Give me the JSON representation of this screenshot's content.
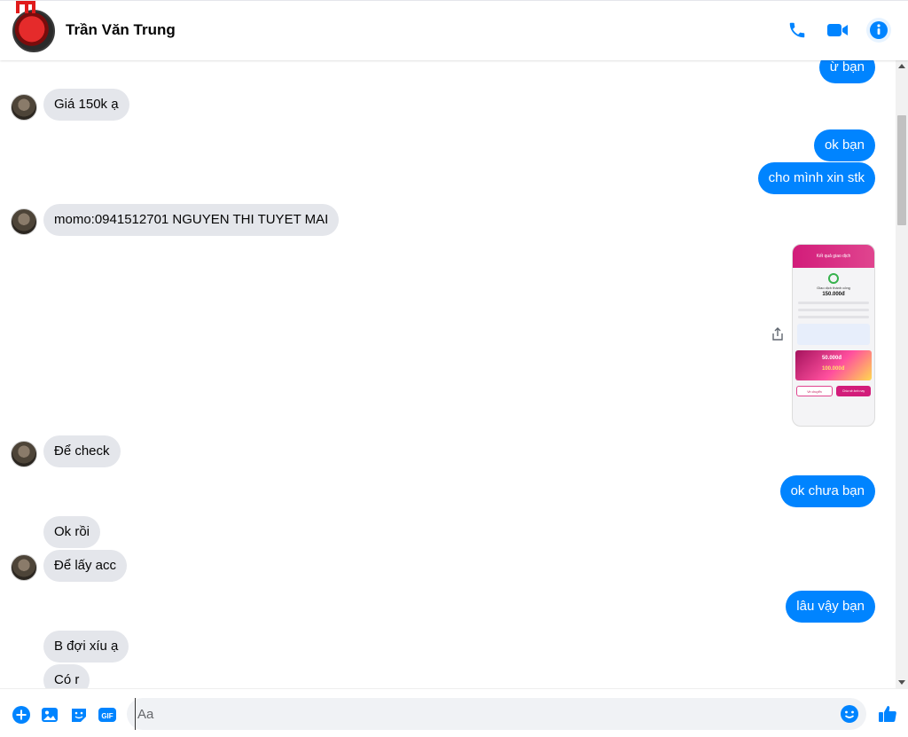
{
  "header": {
    "contact_name": "Trần Văn Trung"
  },
  "messages": [
    {
      "id": "m1",
      "side": "out",
      "text": "ừ bạn"
    },
    {
      "id": "m2",
      "side": "in",
      "text": "Giá 150k ạ"
    },
    {
      "id": "m3",
      "side": "out",
      "text": "ok bạn"
    },
    {
      "id": "m4",
      "side": "out",
      "text": "cho mình xin stk"
    },
    {
      "id": "m5",
      "side": "in",
      "text": "momo:0941512701 NGUYEN THI TUYET MAI"
    },
    {
      "id": "m6",
      "side": "in",
      "text": "Để check"
    },
    {
      "id": "m7",
      "side": "out",
      "text": "ok chưa bạn"
    },
    {
      "id": "m8",
      "side": "in",
      "text": "Ok rồi"
    },
    {
      "id": "m9",
      "side": "in",
      "text": "Để lấy acc"
    },
    {
      "id": "m10",
      "side": "out",
      "text": "lâu vậy bạn"
    },
    {
      "id": "m11",
      "side": "in",
      "text": "B đợi xíu ạ"
    },
    {
      "id": "m12",
      "side": "in",
      "text": "Có r"
    }
  ],
  "receipt": {
    "header_text": "Kết quả giao dịch",
    "status_text": "Giao dịch thành công",
    "amount": "150.000đ",
    "banner_top": "50.000đ",
    "banner_bottom": "100.000đ",
    "btn_left": "Về chuyển",
    "btn_right": "Chia sẻ ảnh nay"
  },
  "composer": {
    "placeholder": "Aa",
    "value": ""
  },
  "colors": {
    "accent": "#0084ff",
    "incoming_bubble": "#e4e6eb"
  }
}
